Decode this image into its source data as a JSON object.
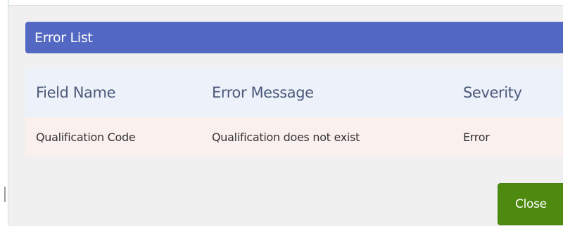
{
  "dialog": {
    "title": "Error List",
    "columns": [
      "Field Name",
      "Error Message",
      "Severity"
    ],
    "rows": [
      {
        "field_name": "Qualification Code",
        "error_message": "Qualification does not exist",
        "severity": "Error"
      }
    ],
    "close_label": "Close"
  },
  "colors": {
    "header_bg": "#5368c2",
    "table_header_bg": "#edf2fa",
    "row_bg": "#faf1ef",
    "close_button_bg": "#4f8a10",
    "dialog_bg": "#f0f0f0"
  }
}
